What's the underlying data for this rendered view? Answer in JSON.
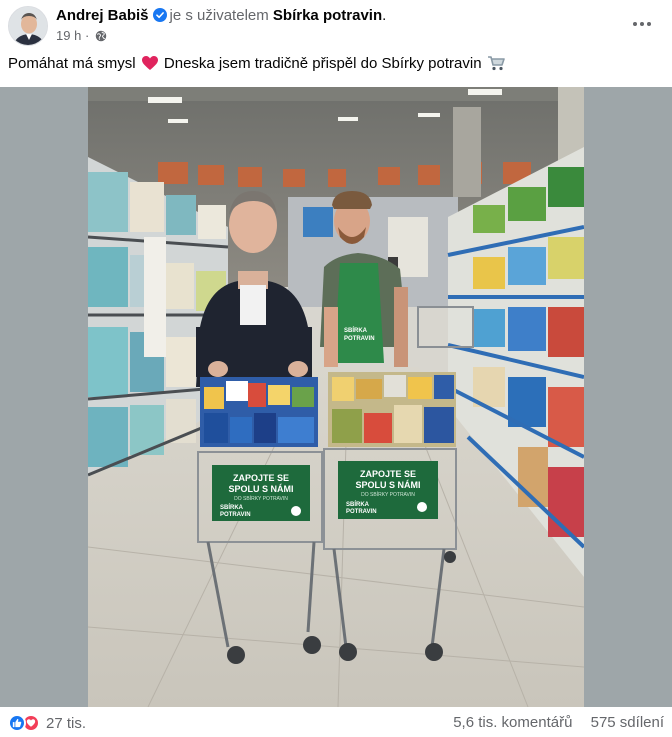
{
  "post": {
    "author": "Andrej Babiš",
    "verified_icon": "verified-badge-icon",
    "with_text": "je s uživatelem",
    "page_name": "Sbírka potravin",
    "punctuation": ".",
    "time": "19 h",
    "time_separator": "·",
    "audience_icon": "globe-icon",
    "more_icon": "more-dots-icon",
    "text_part1": "Pomáhat má smysl",
    "text_part2": "Dneska jsem tradičně přispěl do Sbírky potravin",
    "emoji_1": "heart-emoji",
    "emoji_2": "shopping-cart-emoji",
    "photo": {
      "description_icon": "photo",
      "cart_sign_1_line1": "ZAPOJTE SE",
      "cart_sign_1_line2": "SPOLU S NÁMI",
      "cart_sign_1_line3": "DO SBÍRKY POTRAVIN",
      "cart_sign_1_logo_line1": "SBÍRKA",
      "cart_sign_1_logo_line2": "POTRAVIN",
      "cart_sign_2_line1": "ZAPOJTE SE",
      "cart_sign_2_line2": "SPOLU S NÁMI",
      "cart_sign_2_line3": "DO SBÍRKY POTRAVIN",
      "cart_sign_2_logo_line1": "SBÍRKA",
      "cart_sign_2_logo_line2": "POTRAVIN",
      "apron_line1": "SBÍRKA",
      "apron_line2": "POTRAVIN"
    }
  },
  "footer": {
    "reaction_icons": [
      "like-icon",
      "love-icon"
    ],
    "reaction_count": "27 tis.",
    "comments": "5,6 tis. komentářů",
    "shares": "575 sdílení"
  },
  "colors": {
    "facebook_blue": "#1877f2",
    "love_red": "#f33e58",
    "secondary_text": "#65676b",
    "sign_green": "#1e6a3c",
    "apron_green": "#2e8a4a"
  }
}
